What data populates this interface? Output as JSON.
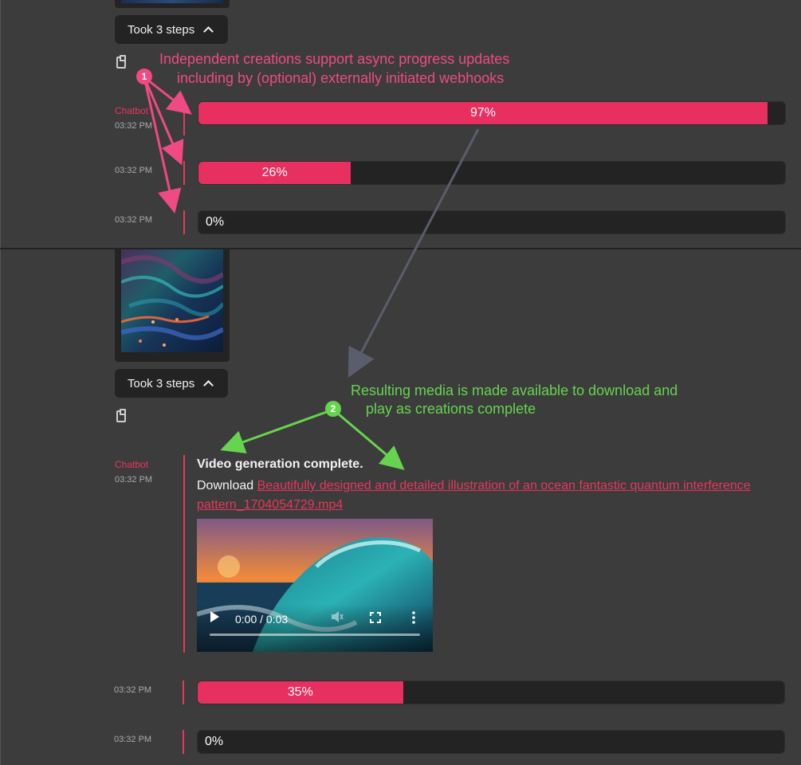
{
  "top": {
    "steps_label": "Took 3 steps",
    "message": {
      "author": "Chatbot",
      "time": "03:32 PM"
    },
    "progress": [
      {
        "time": "03:32 PM",
        "value": 0.97,
        "label": "97%"
      },
      {
        "time": "03:32 PM",
        "value": 0.26,
        "label": "26%"
      },
      {
        "time": "03:32 PM",
        "value": 0.0,
        "label": "0%"
      }
    ]
  },
  "bottom": {
    "steps_label": "Took 3 steps",
    "message": {
      "author": "Chatbot",
      "time": "03:32 PM",
      "title": "Video generation complete.",
      "download_prefix": "Download ",
      "download_link": "Beautifully designed and detailed illustration of an ocean fantastic quantum interference pattern_1704054729.mp4"
    },
    "video": {
      "time_display": "0:00 / 0:03"
    },
    "progress": [
      {
        "time": "03:32 PM",
        "value": 0.35,
        "label": "35%"
      },
      {
        "time": "03:32 PM",
        "value": 0.0,
        "label": "0%"
      }
    ]
  },
  "annotations": {
    "one": {
      "badge": "1",
      "line1": "Independent creations support async progress updates",
      "line2": "including by (optional) externally initiated webhooks",
      "color": "#ef4a83"
    },
    "two": {
      "badge": "2",
      "line1": "Resulting media is made available to download and",
      "line2": "play as creations complete",
      "color": "#66d44f"
    }
  },
  "colors": {
    "accent": "#e72f60",
    "background": "#3c3c3c",
    "bar_track": "#232323"
  }
}
